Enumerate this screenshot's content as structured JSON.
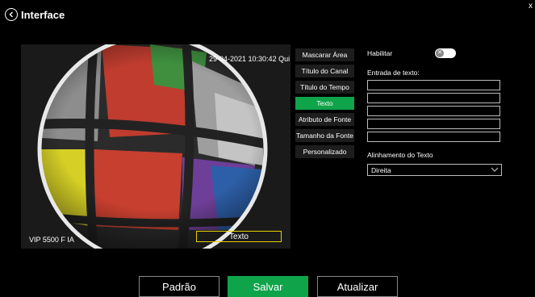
{
  "window": {
    "title": "Interface",
    "close_label": "x"
  },
  "preview": {
    "timestamp": "29-04-2021 10:30:42 Qui",
    "camera_name": "VIP 5500 F IA",
    "overlay_text": "Texto"
  },
  "menu": {
    "items": [
      {
        "label": "Mascarar Área"
      },
      {
        "label": "Título do Canal"
      },
      {
        "label": "Título do Tempo"
      },
      {
        "label": "Texto"
      },
      {
        "label": "Atributo de Fonte"
      },
      {
        "label": "Tamanho da Fonte"
      },
      {
        "label": "Personalizado"
      }
    ],
    "active_index": 3
  },
  "settings": {
    "enable_label": "Habilitar",
    "enabled": false,
    "text_input_label": "Entrada de texto:",
    "text_lines": [
      "",
      "",
      "",
      "",
      ""
    ],
    "alignment_label": "Alinhamento do Texto",
    "alignment_value": "Direita"
  },
  "footer": {
    "default_label": "Padrão",
    "save_label": "Salvar",
    "refresh_label": "Atualizar"
  },
  "colors": {
    "accent": "#0fa44a",
    "overlay_border": "#e6d200"
  }
}
